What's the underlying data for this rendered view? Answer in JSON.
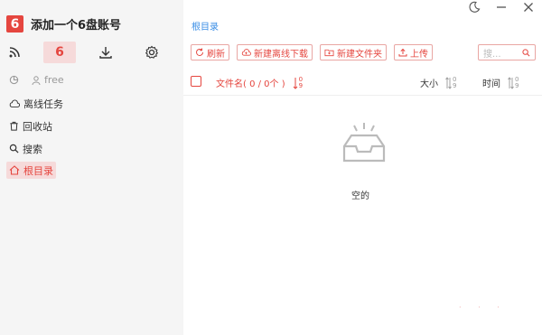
{
  "app": {
    "logo_char": "6",
    "title": "添加一个6盘账号"
  },
  "sidebar": {
    "tool_six_label": "6",
    "account_name": "free",
    "nav": [
      {
        "label": "离线任务",
        "icon": "cloud-icon"
      },
      {
        "label": "回收站",
        "icon": "trash-icon"
      },
      {
        "label": "搜索",
        "icon": "search-icon"
      },
      {
        "label": "根目录",
        "icon": "home-icon",
        "active": true
      }
    ]
  },
  "main": {
    "breadcrumb": "根目录",
    "actions": {
      "refresh": "刷新",
      "new_offline": "新建离线下载",
      "new_folder": "新建文件夹",
      "upload": "上传"
    },
    "search_placeholder": "搜...",
    "table": {
      "name_header": "文件名( 0 / 0个 )",
      "size_header": "大小",
      "time_header": "时间"
    },
    "empty_text": "空的"
  },
  "colors": {
    "accent": "#e5463f",
    "accent_light": "#f6dada",
    "link": "#3a8ee6"
  }
}
